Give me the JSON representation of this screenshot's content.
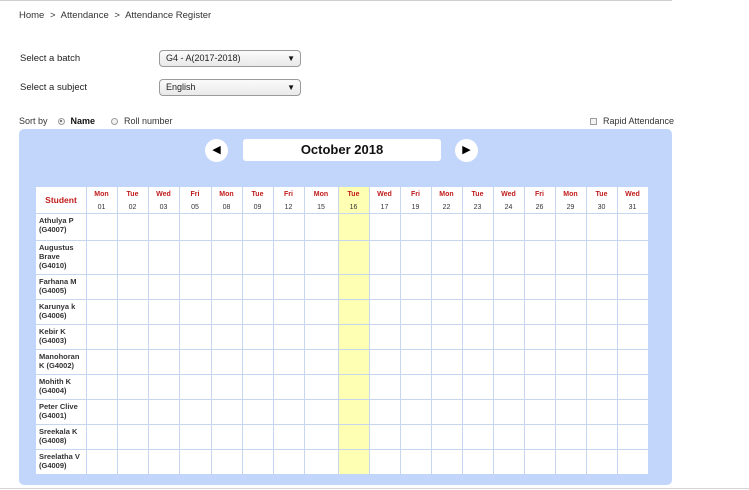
{
  "breadcrumb": [
    "Home",
    ">",
    "Attendance",
    ">",
    "Attendance Register"
  ],
  "form": {
    "batch_label": "Select a batch",
    "batch_value": "G4 - A(2017-2018)",
    "subject_label": "Select a subject",
    "subject_value": "English"
  },
  "sort": {
    "label": "Sort by",
    "options": [
      "Name",
      "Roll number"
    ],
    "selected": "Name"
  },
  "rapid_label": "Rapid Attendance",
  "calendar": {
    "month": "October 2018",
    "prev_icon": "◀",
    "next_icon": "▶",
    "highlight_color": "#ffffb3",
    "panel_color": "#c2d6fb",
    "student_header": "Student",
    "highlighted_day": "16",
    "days": [
      {
        "name": "Mon",
        "num": "01"
      },
      {
        "name": "Tue",
        "num": "02"
      },
      {
        "name": "Wed",
        "num": "03"
      },
      {
        "name": "Fri",
        "num": "05"
      },
      {
        "name": "Mon",
        "num": "08"
      },
      {
        "name": "Tue",
        "num": "09"
      },
      {
        "name": "Fri",
        "num": "12"
      },
      {
        "name": "Mon",
        "num": "15"
      },
      {
        "name": "Tue",
        "num": "16"
      },
      {
        "name": "Wed",
        "num": "17"
      },
      {
        "name": "Fri",
        "num": "19"
      },
      {
        "name": "Mon",
        "num": "22"
      },
      {
        "name": "Tue",
        "num": "23"
      },
      {
        "name": "Wed",
        "num": "24"
      },
      {
        "name": "Fri",
        "num": "26"
      },
      {
        "name": "Mon",
        "num": "29"
      },
      {
        "name": "Tue",
        "num": "30"
      },
      {
        "name": "Wed",
        "num": "31"
      }
    ],
    "students": [
      {
        "name": "Athulya P (G4007)"
      },
      {
        "name": "Augustus Brave (G4010)"
      },
      {
        "name": "Farhana M (G4005)"
      },
      {
        "name": "Karunya k (G4006)"
      },
      {
        "name": "Kebir K (G4003)"
      },
      {
        "name": "Manohoran K (G4002)"
      },
      {
        "name": "Mohith K (G4004)"
      },
      {
        "name": "Peter Clive (G4001)"
      },
      {
        "name": "Sreekala K (G4008)"
      },
      {
        "name": "Sreelatha V (G4009)"
      }
    ]
  }
}
